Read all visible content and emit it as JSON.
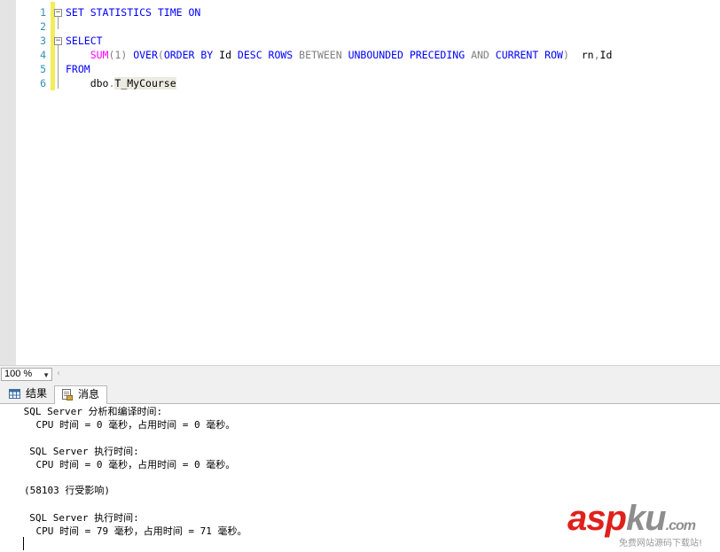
{
  "editor": {
    "line_numbers": [
      "1",
      "2",
      "3",
      "4",
      "5",
      "6"
    ],
    "lines": [
      [
        {
          "t": "SET STATISTICS TIME ON",
          "c": "kw"
        }
      ],
      [],
      [
        {
          "t": "SELECT",
          "c": "kw"
        }
      ],
      [
        {
          "t": "    ",
          "c": "tx"
        },
        {
          "t": "SUM",
          "c": "fn"
        },
        {
          "t": "(1) ",
          "c": "gr"
        },
        {
          "t": "OVER",
          "c": "kw"
        },
        {
          "t": "(",
          "c": "gr"
        },
        {
          "t": "ORDER BY",
          "c": "kw"
        },
        {
          "t": " Id ",
          "c": "tx"
        },
        {
          "t": "DESC ROWS",
          "c": "kw"
        },
        {
          "t": " ",
          "c": "tx"
        },
        {
          "t": "BETWEEN",
          "c": "gr"
        },
        {
          "t": " ",
          "c": "tx"
        },
        {
          "t": "UNBOUNDED PRECEDING",
          "c": "kw"
        },
        {
          "t": " ",
          "c": "tx"
        },
        {
          "t": "AND",
          "c": "gr"
        },
        {
          "t": " ",
          "c": "tx"
        },
        {
          "t": "CURRENT ROW",
          "c": "kw"
        },
        {
          "t": ")",
          "c": "gr"
        },
        {
          "t": "  rn",
          "c": "tx"
        },
        {
          "t": ",",
          "c": "gr"
        },
        {
          "t": "Id",
          "c": "tx"
        }
      ],
      [
        {
          "t": "FROM",
          "c": "kw"
        }
      ],
      [
        {
          "t": "    dbo",
          "c": "tx"
        },
        {
          "t": ".",
          "c": "gr"
        },
        {
          "t": "T_MyCourse",
          "c": "hl"
        }
      ]
    ]
  },
  "zoom": {
    "value": "100 %"
  },
  "tabs": {
    "results": "结果",
    "messages": "消息"
  },
  "messages": {
    "lines": [
      " SQL Server 分析和编译时间:",
      "    CPU 时间 = 0 毫秒，占用时间 = 0 毫秒。",
      "",
      "  SQL Server 执行时间:",
      "    CPU 时间 = 0 毫秒，占用时间 = 0 毫秒。",
      "",
      "(58103 行受影响)",
      "",
      "  SQL Server 执行时间:",
      "    CPU 时间 = 79 毫秒，占用时间 = 71 毫秒。"
    ]
  },
  "watermark": {
    "asp": "asp",
    "ku": "ku",
    "com": ".com",
    "subtitle": "免费网站源码下载站!"
  }
}
